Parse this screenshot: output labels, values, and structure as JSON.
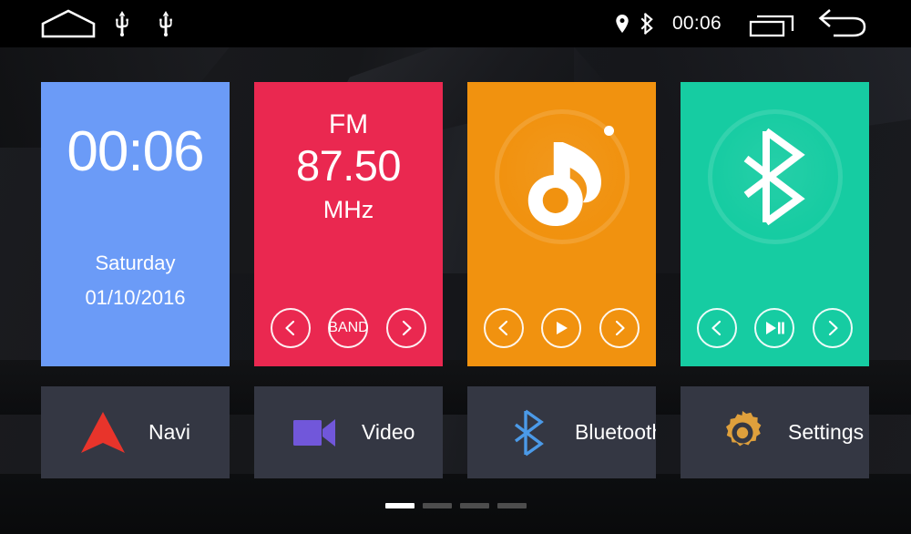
{
  "statusbar": {
    "time": "00:06",
    "left_icons": [
      {
        "name": "home-icon",
        "label": "Home"
      },
      {
        "name": "usb-icon-1",
        "label": "USB 1"
      },
      {
        "name": "usb-icon-2",
        "label": "USB 2"
      }
    ],
    "right_icons": [
      {
        "name": "location-pin-icon",
        "label": "GPS"
      },
      {
        "name": "bluetooth-status-icon",
        "label": "Bluetooth"
      },
      {
        "name": "recent-apps-icon",
        "label": "Recent apps"
      },
      {
        "name": "back-arrow-icon",
        "label": "Back"
      }
    ]
  },
  "tiles": {
    "clock": {
      "time": "00:06",
      "weekday": "Saturday",
      "date": "01/10/2016",
      "color": "#6b9bf7"
    },
    "radio": {
      "band": "FM",
      "frequency": "87.50",
      "unit": "MHz",
      "color": "#ea2850",
      "controls": [
        {
          "name": "radio-prev-button",
          "label": "Previous station"
        },
        {
          "name": "radio-band-button",
          "label": "BAND"
        },
        {
          "name": "radio-next-button",
          "label": "Next station"
        }
      ]
    },
    "music": {
      "icon": "music-note-icon",
      "color": "#f1920f",
      "controls": [
        {
          "name": "music-prev-button",
          "label": "Previous track"
        },
        {
          "name": "music-play-button",
          "label": "Play"
        },
        {
          "name": "music-next-button",
          "label": "Next track"
        }
      ]
    },
    "bluetooth": {
      "icon": "bluetooth-icon",
      "color": "#16cca2",
      "controls": [
        {
          "name": "bt-prev-button",
          "label": "Previous"
        },
        {
          "name": "bt-playpause-button",
          "label": "Play / Pause"
        },
        {
          "name": "bt-next-button",
          "label": "Next"
        }
      ]
    }
  },
  "apps": [
    {
      "label": "Navi",
      "icon": "navigation-arrow-icon",
      "icon_color": "#e8342b"
    },
    {
      "label": "Video",
      "icon": "video-camera-icon",
      "icon_color": "#7157da"
    },
    {
      "label": "Bluetooth",
      "icon": "bluetooth-icon",
      "icon_color": "#4b9ae8"
    },
    {
      "label": "Settings",
      "icon": "gear-icon",
      "icon_color": "#dfa03c"
    }
  ],
  "pager": {
    "pages": 4,
    "active_index": 1,
    "active_color": "#ffffff",
    "inactive_color": "#4d4d4d"
  },
  "theme": {
    "background": "#121316",
    "statusbar_background": "#000000",
    "app_tile_background": "#343743"
  }
}
